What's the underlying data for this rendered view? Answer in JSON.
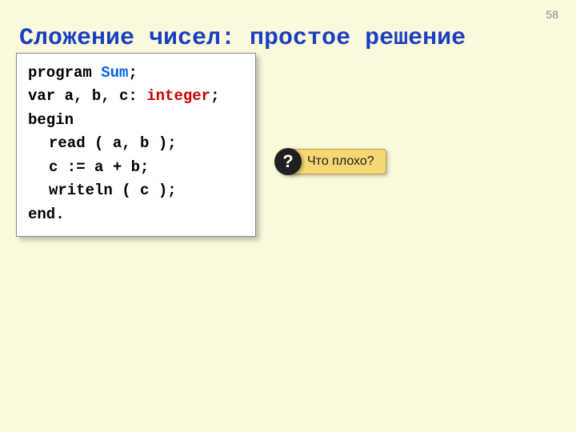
{
  "page_number": "58",
  "title": "Сложение чисел: простое решение",
  "code": {
    "l1_kw": "program ",
    "l1_name": "Sum",
    "l1_semi": ";",
    "l2_a": "var a, b, c: ",
    "l2_type": "integer",
    "l2_semi": ";",
    "l3": "begin",
    "l4": "read ( a, b );",
    "l5": "c := a + b;",
    "l6": "writeln ( c );",
    "l7": "end."
  },
  "callout": {
    "badge": "?",
    "text": "Что плохо?"
  }
}
